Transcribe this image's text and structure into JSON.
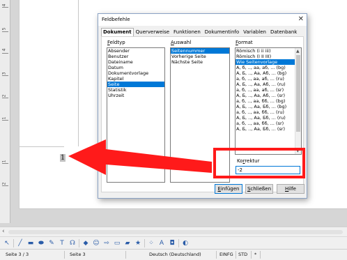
{
  "ruler": {
    "numbers": [
      "4",
      "5",
      "4",
      "3",
      "2",
      "1",
      "1",
      "2"
    ]
  },
  "document": {
    "field_value": "1"
  },
  "dialog": {
    "title": "Feldbefehle",
    "close_glyph": "✕",
    "tabs": [
      "Dokument",
      "Querverweise",
      "Funktionen",
      "Dokumentinfo",
      "Variablen",
      "Datenbank"
    ],
    "feldtyp": {
      "label_u": "F",
      "label_rest": "eldtyp",
      "items": [
        "Absender",
        "Benutzer",
        "Dateiname",
        "Datum",
        "Dokumentvorlage",
        "Kapitel",
        "Seite",
        "Statistik",
        "Uhrzeit"
      ],
      "selected": "Seite"
    },
    "auswahl": {
      "label_u": "A",
      "label_rest": "uswahl",
      "items": [
        "Seitennummer",
        "Vorherige Seite",
        "Nächste Seite"
      ],
      "selected": "Seitennummer"
    },
    "format": {
      "label_u": "F",
      "label_rest": "ormat",
      "items": [
        "Römisch (i ii iii)",
        "Römisch (I II III)",
        "Wie Seitenvorlage",
        "A, б, .., aa, aб, ... (bg)",
        "A, Б, .., Aa, Aб, ... (bg)",
        "a, б, .., aa, aб, ... (ru)",
        "A, Б, .., Aa, Aб, ... (ru)",
        "a, б, .., aa, aб, ... (sr)",
        "A, Б, .., Aa, Aб, ... (sr)",
        "a, б, .., aa, бб, ... (bg)",
        "A, Б, .., Aa, Бб, ... (bg)",
        "a, б, .., aa, бб, ... (ru)",
        "A, Б, .., Aa, Бб, ... (ru)",
        "a, б, .., aa, бб, ... (sr)",
        "A, Б, .., Aa, Бб, ... (sr)"
      ],
      "selected": "Wie Seitenvorlage"
    },
    "korrektur": {
      "label_pre": "Ko",
      "label_u": "r",
      "label_post": "rektur",
      "value": "-2"
    },
    "buttons": {
      "insert": {
        "u": "E",
        "rest": "infügen"
      },
      "close": {
        "u": "S",
        "rest": "chließen"
      },
      "help": {
        "u": "H",
        "rest": "ilfe"
      }
    }
  },
  "statusbar": {
    "page": "Seite 3 / 3",
    "style": "Seite 3",
    "language": "Deutsch (Deutschland)",
    "insert_mode": "EINFG",
    "selection_mode": "STD",
    "modified": "*"
  },
  "colors": {
    "accent": "#0078d7",
    "highlight": "#ff1a1a"
  }
}
